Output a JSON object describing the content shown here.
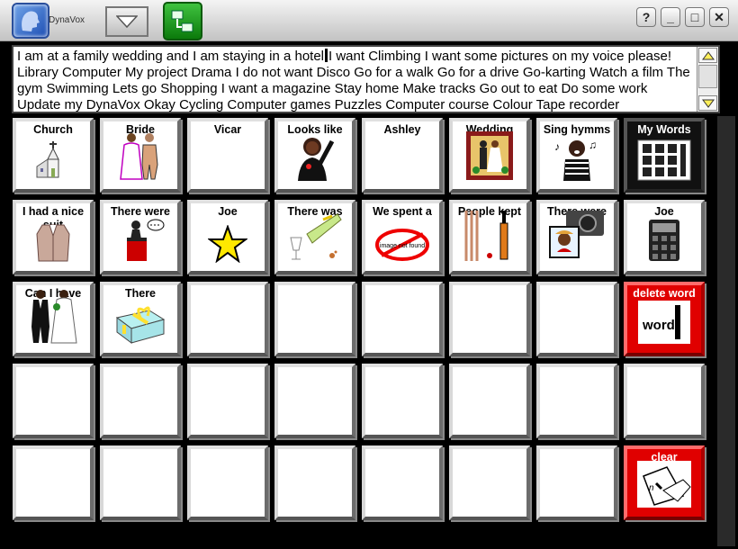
{
  "app": {
    "name": "DynaVox"
  },
  "window_buttons": [
    "?",
    "_",
    "□",
    "✕"
  ],
  "message": {
    "before_caret": "I am at a family wedding and I am staying in a hotel",
    "after_caret": "I want Climbing I want some pictures on my voice please! Library Computer My project Drama I do not want Disco Go for a walk Go for a drive Go-karting Watch a film The gym Swimming Lets go Shopping I want a magazine Stay home Make tracks Go out to eat Do some work Update my DynaVox Okay Cycling Computer games Puzzles Computer course Colour Tape recorder"
  },
  "buttons": [
    [
      {
        "label": "Church",
        "icon": "church-icon"
      },
      {
        "label": "Bride",
        "icon": "bride-groom-icon"
      },
      {
        "label": "Vicar",
        "icon": ""
      },
      {
        "label": "Looks like",
        "icon": "person-pointing-icon"
      },
      {
        "label": "Ashley",
        "icon": ""
      },
      {
        "label": "Wedding",
        "icon": "wedding-photo-icon"
      },
      {
        "label": "Sing hymms",
        "icon": "singing-person-icon"
      },
      {
        "label": "My Words",
        "icon": "word-grid-icon",
        "style": "dark"
      }
    ],
    [
      {
        "label": "I had a nice suit",
        "icon": "suit-icon"
      },
      {
        "label": "There were",
        "icon": "speaker-podium-icon"
      },
      {
        "label": "Joe",
        "icon": "star-icon"
      },
      {
        "label": "There was",
        "icon": "champagne-icon"
      },
      {
        "label": "We spent a",
        "icon": "image-not-found-icon"
      },
      {
        "label": "People kept",
        "icon": "cricket-icon"
      },
      {
        "label": "There were",
        "icon": "camera-icon"
      },
      {
        "label": "Joe",
        "icon": "calculator-icon"
      }
    ],
    [
      {
        "label": "Can I have",
        "icon": "wedding-couple-icon"
      },
      {
        "label": "There",
        "icon": "gift-icon"
      },
      {
        "label": "",
        "icon": ""
      },
      {
        "label": "",
        "icon": ""
      },
      {
        "label": "",
        "icon": ""
      },
      {
        "label": "",
        "icon": ""
      },
      {
        "label": "",
        "icon": ""
      },
      {
        "label": "delete word",
        "icon": "delete-word-icon",
        "style": "red"
      }
    ],
    [
      {
        "label": "",
        "icon": ""
      },
      {
        "label": "",
        "icon": ""
      },
      {
        "label": "",
        "icon": ""
      },
      {
        "label": "",
        "icon": ""
      },
      {
        "label": "",
        "icon": ""
      },
      {
        "label": "",
        "icon": ""
      },
      {
        "label": "",
        "icon": ""
      },
      {
        "label": "",
        "icon": ""
      }
    ],
    [
      {
        "label": "",
        "icon": ""
      },
      {
        "label": "",
        "icon": ""
      },
      {
        "label": "",
        "icon": ""
      },
      {
        "label": "",
        "icon": ""
      },
      {
        "label": "",
        "icon": ""
      },
      {
        "label": "",
        "icon": ""
      },
      {
        "label": "",
        "icon": ""
      },
      {
        "label": "clear",
        "icon": "clear-hand-icon",
        "style": "red"
      }
    ]
  ],
  "word_image_text": "word",
  "not_found_text": "image not found",
  "colors": {
    "delete": "#e00000",
    "green": "#1a9a1a",
    "logo": "#2a5fc4"
  }
}
